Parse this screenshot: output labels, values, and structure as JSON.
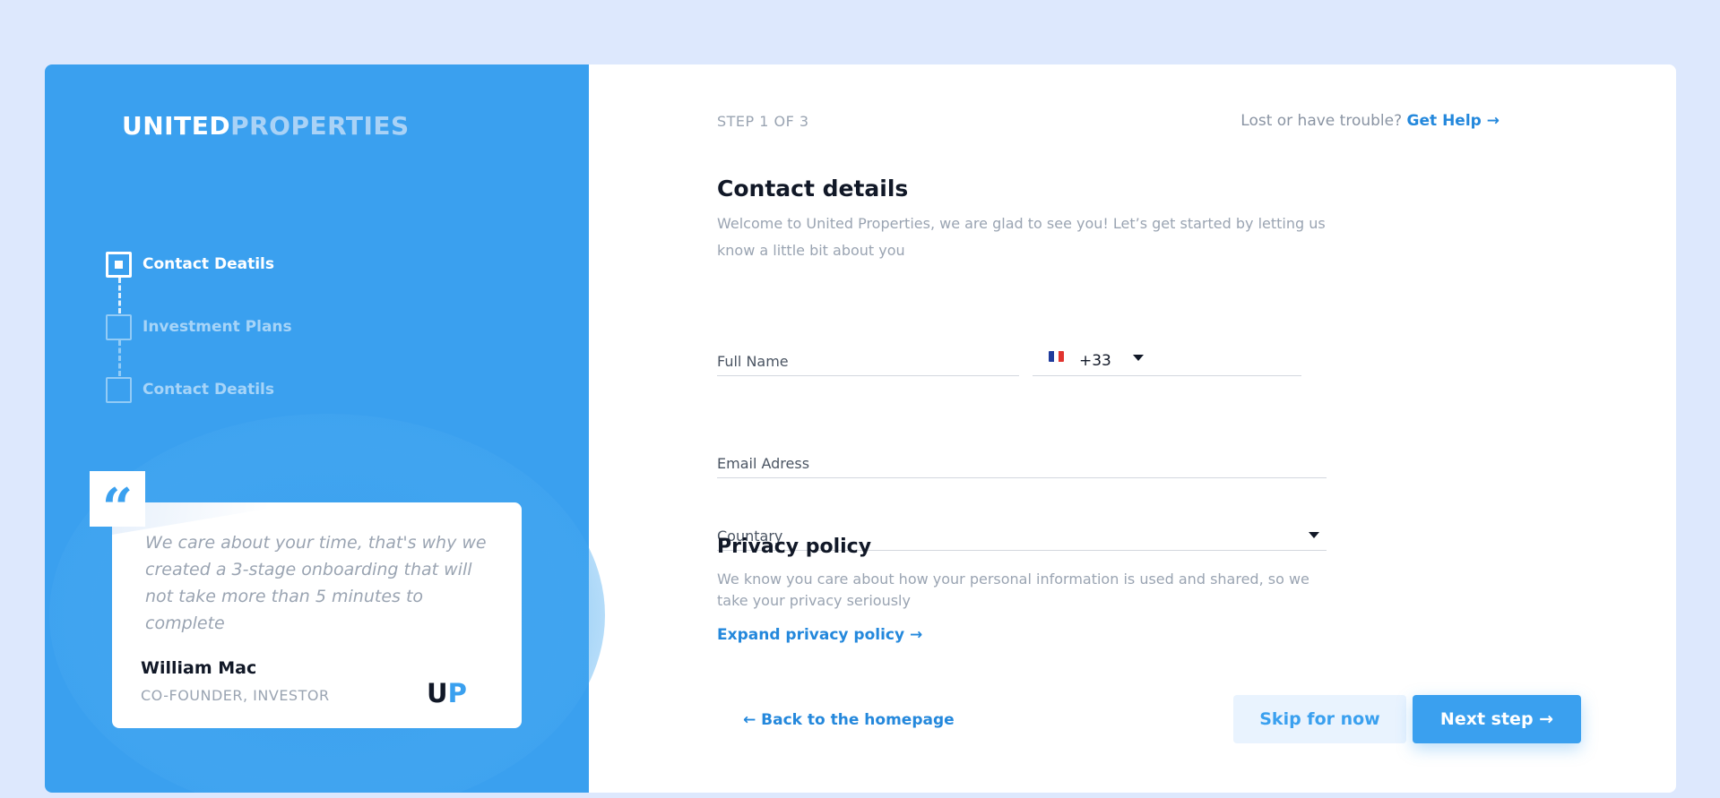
{
  "brand": {
    "logo_part1": "UNITED",
    "logo_part2": "PROPERTIES",
    "accent": "#3aa0ef",
    "link": "#2488dc",
    "background": "#dde8fd"
  },
  "steps": [
    {
      "label": "Contact Deatils",
      "state": "active",
      "icon": "checkbox-active-icon"
    },
    {
      "label": "Investment Plans",
      "state": "inactive",
      "icon": "checkbox-icon"
    },
    {
      "label": "Contact Deatils",
      "state": "inactive",
      "icon": "checkbox-icon"
    }
  ],
  "testimonial": {
    "quote_icon": "quote-icon",
    "text": "We care about your time, that's why we created a 3-stage onboarding that will not take more than 5 minutes to complete",
    "author": "William Mac",
    "role": "CO-FOUNDER, INVESTOR",
    "logo_u": "U",
    "logo_p": "P"
  },
  "header": {
    "step_counter": "STEP 1 OF 3",
    "help_text": "Lost or have trouble?",
    "help_link": "Get Help →"
  },
  "form": {
    "title": "Contact details",
    "subtitle": "Welcome to United Properties, we are glad to see you! Let’s get started by letting us know a little bit about you",
    "full_name_placeholder": "Full Name",
    "phone_flag": "france-flag-icon",
    "phone_code": "+33",
    "email_placeholder": "Email Adress",
    "country_placeholder": "Countary"
  },
  "privacy": {
    "title": "Privacy policy",
    "text": "We know you care about how your personal information is used and shared, so we take your privacy seriously",
    "expand_link": "Expand privacy policy →"
  },
  "footer": {
    "back_link": "← Back to the homepage",
    "skip_label": "Skip for now",
    "next_label": "Next step →"
  }
}
